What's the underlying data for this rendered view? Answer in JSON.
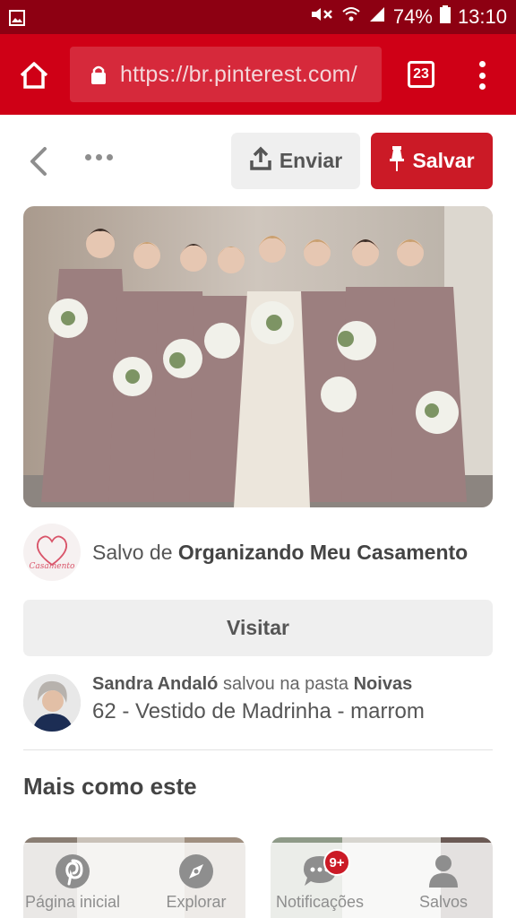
{
  "status_bar": {
    "battery": "74%",
    "time": "13:10"
  },
  "browser": {
    "url": "https://br.pinterest.com/",
    "tab_count": "23"
  },
  "actions": {
    "send_label": "Enviar",
    "save_label": "Salvar"
  },
  "source": {
    "prefix": "Salvo de ",
    "board": "Organizando Meu Casamento",
    "logo_text": "Casamento"
  },
  "visit_label": "Visitar",
  "saver": {
    "name": "Sandra Andaló",
    "middle": " salvou na pasta ",
    "folder": "Noivas",
    "pin_title": "62 - Vestido de Madrinha - marrom"
  },
  "more_title": "Mais como este",
  "nav": {
    "home": "Página inicial",
    "explore": "Explorar",
    "notifications": "Notificações",
    "notifications_badge": "9+",
    "saved": "Salvos"
  },
  "colors": {
    "brand_red": "#cb1a26",
    "toolbar_red": "#cf0016",
    "status_red": "#8d0012"
  }
}
